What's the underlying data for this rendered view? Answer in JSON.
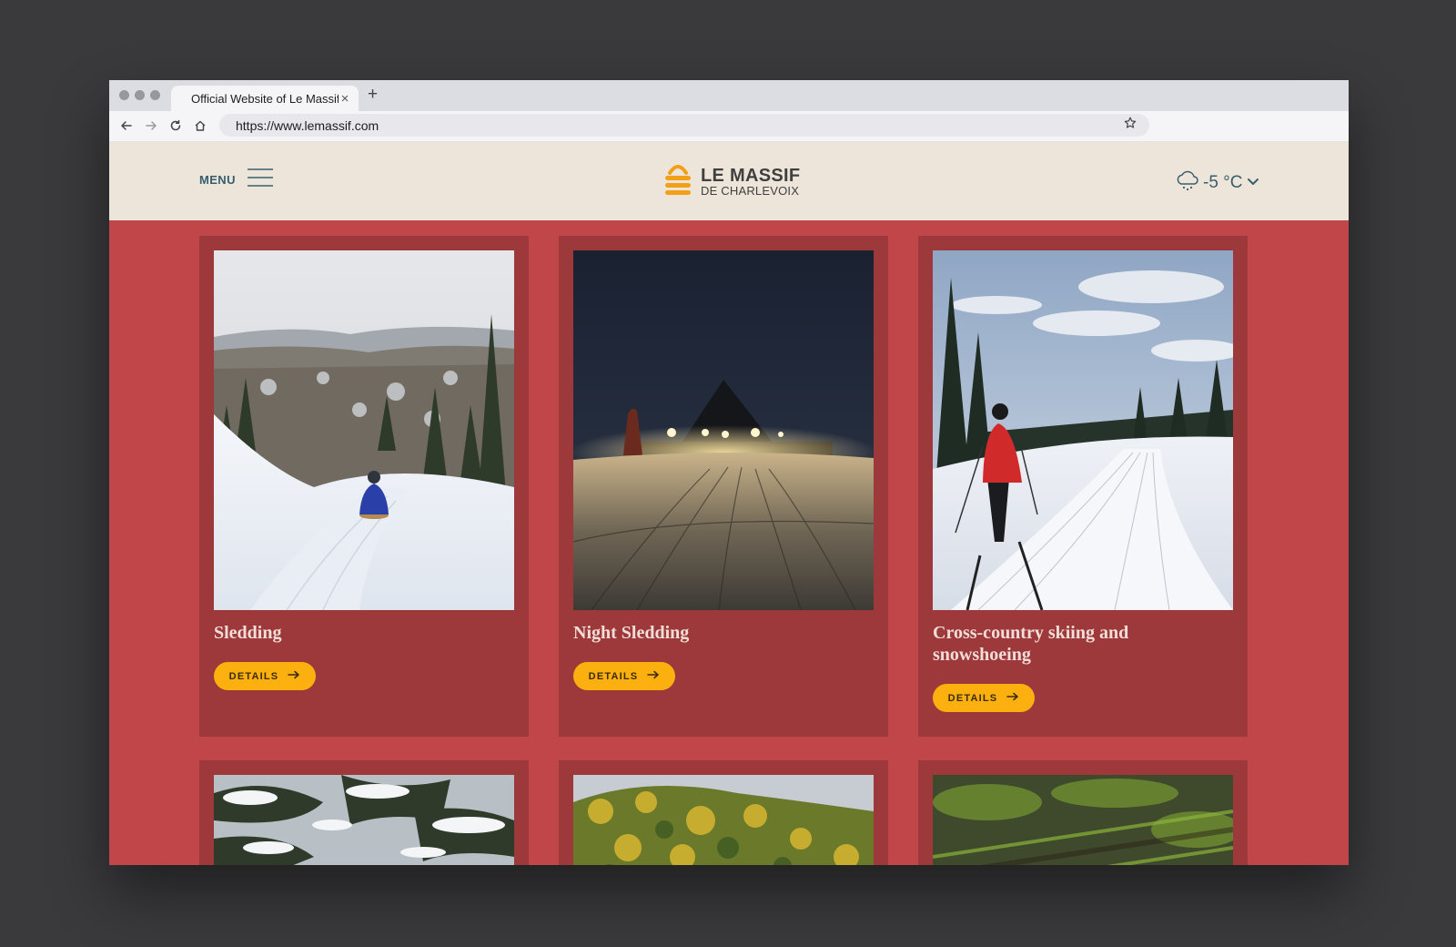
{
  "browser": {
    "tab_title": "Official Website of Le Massif",
    "tab_close": "×",
    "new_tab": "+",
    "url": "https://www.lemassif.com"
  },
  "header": {
    "menu_label": "MENU",
    "logo_line1": "LE MASSIF",
    "logo_line2": "DE CHARLEVOIX",
    "temperature": "-5 °C"
  },
  "cards": [
    {
      "title": "Sledding",
      "button": "DETAILS"
    },
    {
      "title": "Night Sledding",
      "button": "DETAILS"
    },
    {
      "title": "Cross-country skiing and snowshoeing",
      "button": "DETAILS"
    }
  ],
  "colors": {
    "page_red": "#c04649",
    "card_red": "#9d383b",
    "header_beige": "#ede5da",
    "button_yellow": "#fbb00f",
    "accent_teal": "#365e6e",
    "logo_orange": "#f2a116"
  }
}
